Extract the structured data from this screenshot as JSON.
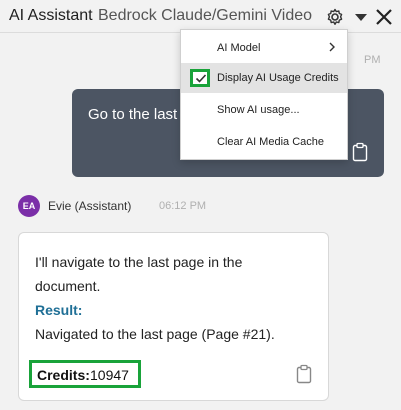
{
  "header": {
    "title": "AI Assistant",
    "model": "Bedrock Claude/Gemini Video"
  },
  "menu": {
    "items": [
      {
        "label": "AI Model"
      },
      {
        "label": "Display AI Usage Credits",
        "checked": true
      },
      {
        "label": "Show AI usage..."
      },
      {
        "label": "Clear AI Media Cache"
      }
    ]
  },
  "chat": {
    "user_message": {
      "text": "Go to the last page",
      "time_behind_menu": "PM",
      "time_behind_menu2": "PM"
    },
    "assistant": {
      "avatar": "EA",
      "name": "Evie (Assistant)",
      "time": "06:12 PM",
      "line1": "I'll navigate to the last page in the",
      "line2": "document.",
      "result_label": "Result:",
      "result_text": "Navigated to the last page (Page #21).",
      "credits_label": "Credits:",
      "credits_value": "10947"
    }
  },
  "colors": {
    "user_bubble": "#4c5563",
    "highlight_green": "#19a33a",
    "avatar": "#7b2fa8",
    "result_label": "#1f6f96"
  }
}
